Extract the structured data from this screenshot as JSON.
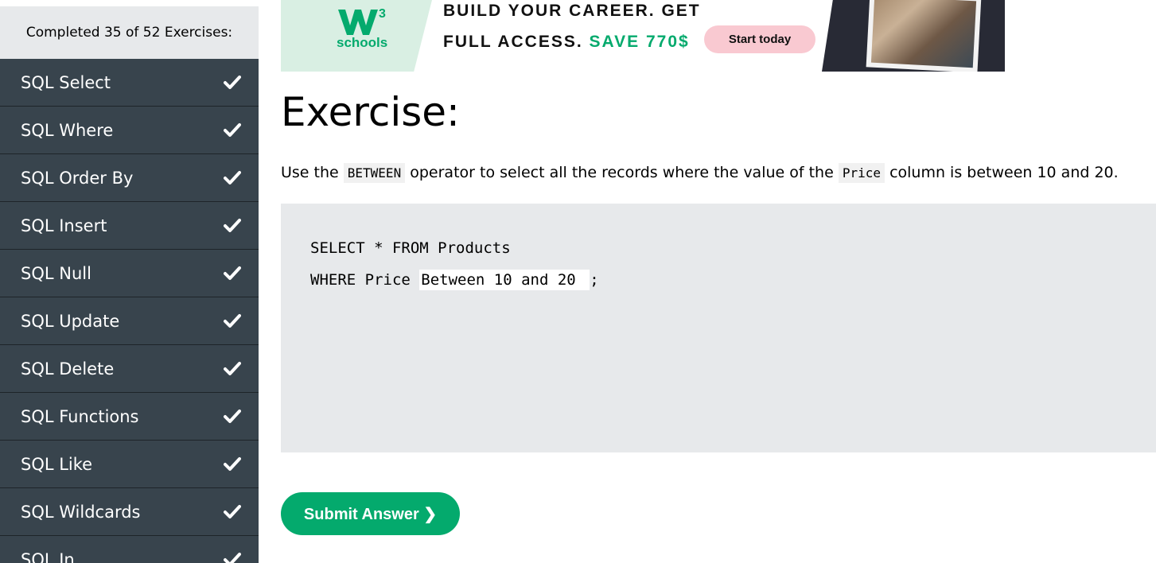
{
  "sidebar": {
    "progress_text": "Completed 35 of 52 Exercises:",
    "items": [
      {
        "label": "SQL Select",
        "completed": true
      },
      {
        "label": "SQL Where",
        "completed": true
      },
      {
        "label": "SQL Order By",
        "completed": true
      },
      {
        "label": "SQL Insert",
        "completed": true
      },
      {
        "label": "SQL Null",
        "completed": true
      },
      {
        "label": "SQL Update",
        "completed": true
      },
      {
        "label": "SQL Delete",
        "completed": true
      },
      {
        "label": "SQL Functions",
        "completed": true
      },
      {
        "label": "SQL Like",
        "completed": true
      },
      {
        "label": "SQL Wildcards",
        "completed": true
      },
      {
        "label": "SQL In",
        "completed": true
      }
    ]
  },
  "banner": {
    "logo_sup": "3",
    "logo_text": "schools",
    "headline_line1": "BUILD YOUR CAREER. GET",
    "headline_line2_prefix": "FULL ACCESS.",
    "headline_line2_highlight": "SAVE 770$",
    "cta_label": "Start today"
  },
  "exercise": {
    "title": "Exercise:",
    "instruction_part1": "Use the",
    "instruction_code1": "BETWEEN",
    "instruction_part2": "operator to select all the records where the value of the",
    "instruction_code2": "Price",
    "instruction_part3": "column is between 10 and 20.",
    "code_line1": "SELECT * FROM Products",
    "code_line2_prefix": "WHERE Price ",
    "answer_value": "Between 10 and 20",
    "code_line2_suffix": ";",
    "submit_label": "Submit Answer ❯"
  },
  "colors": {
    "sidebar_item_bg": "#38444d",
    "accent_green": "#04aa6d",
    "code_bg": "#e7e9eb",
    "cta_pink": "#f9c9d1"
  }
}
